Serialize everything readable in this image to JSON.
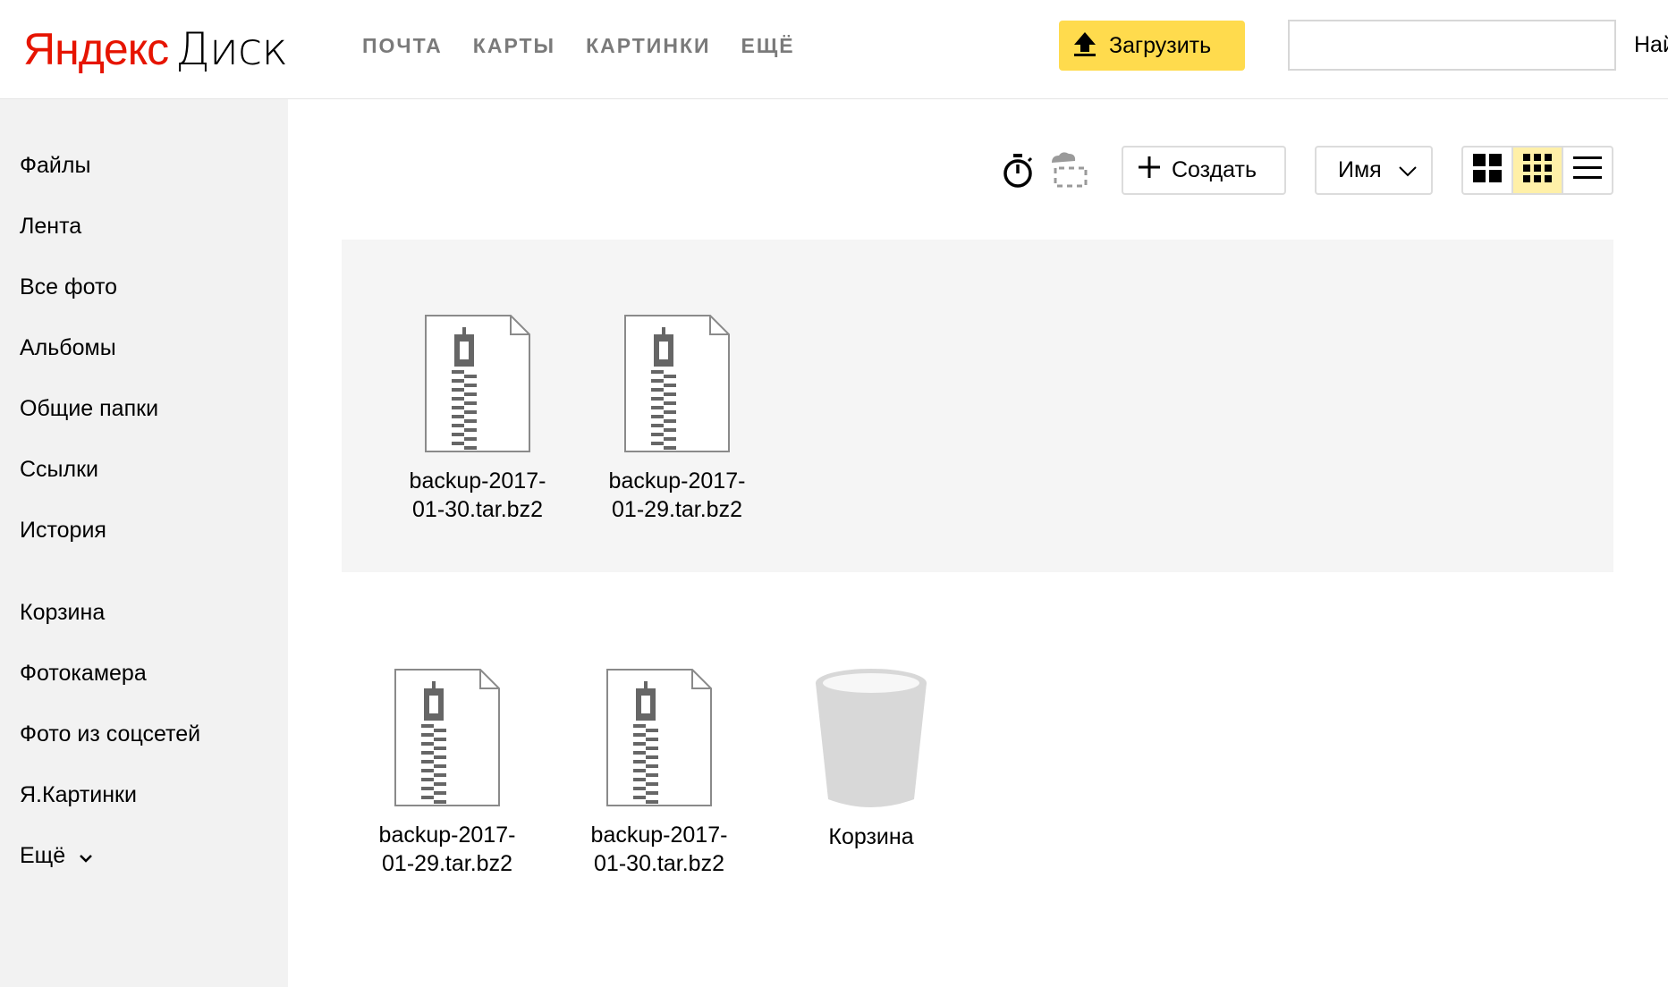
{
  "header": {
    "logo_ya": "Яндекс",
    "logo_disk": "Диск",
    "nav": [
      "ПОЧТА",
      "КАРТЫ",
      "КАРТИНКИ",
      "ЕЩЁ"
    ],
    "upload_label": "Загрузить",
    "search_value": "",
    "search_button": "Найти"
  },
  "sidebar": {
    "items": [
      "Файлы",
      "Лента",
      "Все фото",
      "Альбомы",
      "Общие папки",
      "Ссылки",
      "История",
      "Корзина",
      "Фотокамера",
      "Фото из соцсетей",
      "Я.Картинки",
      "Ещё"
    ]
  },
  "toolbar": {
    "create_label": "Создать",
    "sort_label": "Имя",
    "icons": [
      "stopwatch-icon",
      "cloud-select-icon",
      "plus-icon",
      "chevron-down-icon",
      "large-tiles-icon",
      "small-tiles-icon",
      "list-icon"
    ],
    "active_view": "small-tiles"
  },
  "files": [
    {
      "name1": "backup-2017-",
      "name2": "01-30.tar.bz2",
      "icon": "archive-icon"
    },
    {
      "name1": "backup-2017-",
      "name2": "01-29.tar.bz2",
      "icon": "archive-icon"
    },
    {
      "name1": "backup-2017-",
      "name2": "01-29.tar.bz2",
      "icon": "archive-icon"
    },
    {
      "name1": "backup-2017-",
      "name2": "01-30.tar.bz2",
      "icon": "archive-icon"
    },
    {
      "name1": "Корзина",
      "name2": "",
      "icon": "trash-icon"
    }
  ],
  "colors": {
    "logo_red": "#e61400",
    "upload_yellow": "#ffdb4d",
    "active_view_bg": "#fff0a8",
    "sidebar_bg": "#f2f2f2",
    "nav_gray": "#7a7a7a"
  }
}
